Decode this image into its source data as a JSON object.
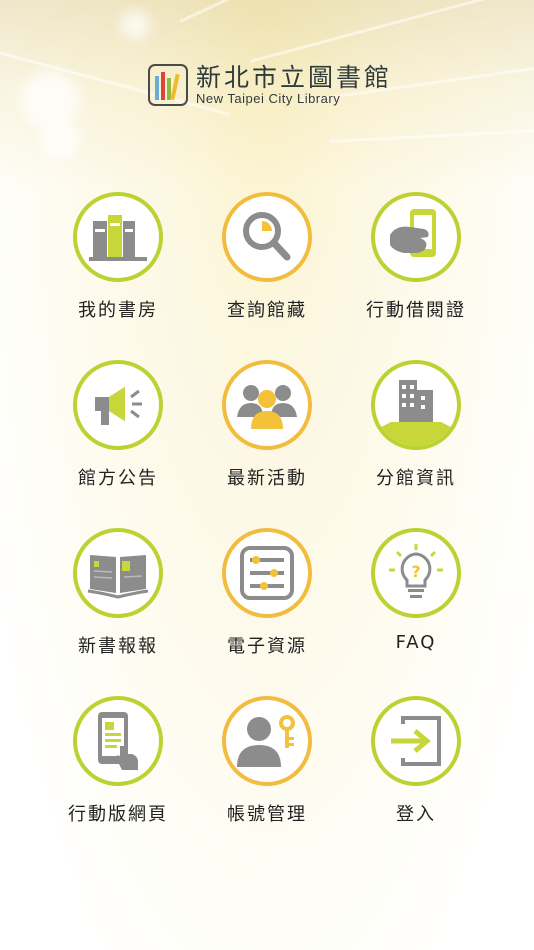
{
  "brand": {
    "title_zh": "新北市立圖書館",
    "title_en": "New Taipei City Library"
  },
  "menu": [
    {
      "label": "我的書房",
      "icon": "books-icon"
    },
    {
      "label": "查詢館藏",
      "icon": "search-icon"
    },
    {
      "label": "行動借閱證",
      "icon": "phone-card-icon"
    },
    {
      "label": "館方公告",
      "icon": "megaphone-icon"
    },
    {
      "label": "最新活動",
      "icon": "people-group-icon"
    },
    {
      "label": "分館資訊",
      "icon": "building-icon"
    },
    {
      "label": "新書報報",
      "icon": "open-book-icon"
    },
    {
      "label": "電子資源",
      "icon": "tablet-icon"
    },
    {
      "label": "FAQ",
      "icon": "lightbulb-icon"
    },
    {
      "label": "行動版網頁",
      "icon": "mobile-web-icon"
    },
    {
      "label": "帳號管理",
      "icon": "user-key-icon"
    },
    {
      "label": "登入",
      "icon": "login-icon"
    }
  ],
  "colors": {
    "green": "#bcd132",
    "orange": "#f2bd3e",
    "gray": "#8c8c8c",
    "accent": "#c9d63a",
    "yellow": "#f3c23a"
  }
}
